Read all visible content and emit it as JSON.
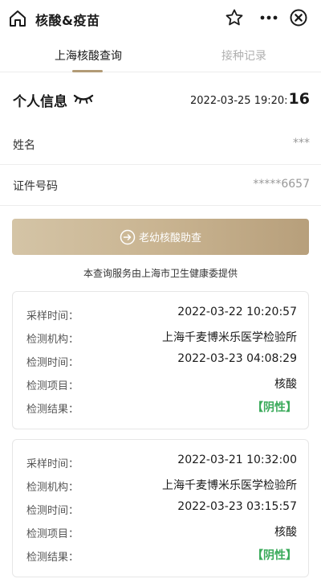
{
  "header": {
    "title": "核酸&疫苗"
  },
  "tabs": [
    {
      "label": "上海核酸查询",
      "active": true
    },
    {
      "label": "接种记录",
      "active": false
    }
  ],
  "personal": {
    "title": "个人信息",
    "timestamp_main": "2022-03-25 19:20:",
    "timestamp_sec": "16",
    "fields": [
      {
        "label": "姓名",
        "value": "***"
      },
      {
        "label": "证件号码",
        "value": "*****6657"
      }
    ]
  },
  "query_button": {
    "label": "老幼核酸助查"
  },
  "provider_note": "本查询服务由上海市卫生健康委提供",
  "records": [
    {
      "rows": [
        {
          "key": "采样时间：",
          "value": "2022-03-22 10:20:57"
        },
        {
          "key": "检测机构：",
          "value": "上海千麦博米乐医学检验所"
        },
        {
          "key": "检测时间：",
          "value": "2022-03-23 04:08:29"
        },
        {
          "key": "检测项目：",
          "value": "核酸"
        },
        {
          "key": "检测结果：",
          "value": "【阴性】"
        }
      ]
    },
    {
      "rows": [
        {
          "key": "采样时间：",
          "value": "2022-03-21 10:32:00"
        },
        {
          "key": "检测机构：",
          "value": "上海千麦博米乐医学检验所"
        },
        {
          "key": "检测时间：",
          "value": "2022-03-23 03:15:57"
        },
        {
          "key": "检测项目：",
          "value": "核酸"
        },
        {
          "key": "检测结果：",
          "value": "【阴性】"
        }
      ]
    }
  ],
  "colors": {
    "accent": "#b29b76",
    "negative_result": "#3aaa5a"
  }
}
